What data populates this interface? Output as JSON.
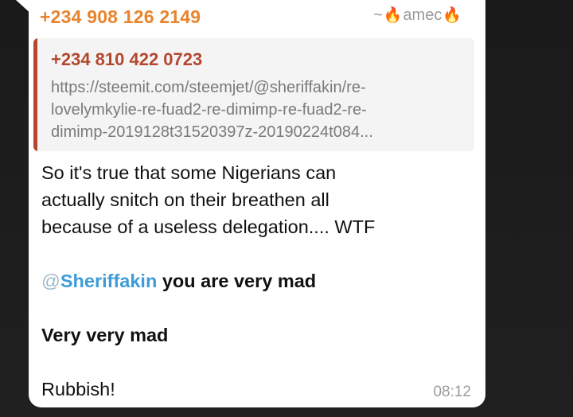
{
  "message": {
    "sender_phone": "+234 908 126 2149",
    "sender_tag_prefix": "~",
    "sender_tag_name": "amec",
    "fire_icon": "🔥",
    "reply": {
      "author": "+234 810 422 0723",
      "line_1": "https://steemit.com/steemjet/@sheriffakin/re-",
      "line_2": "lovelymkylie-re-fuad2-re-dimimp-re-fuad2-re-",
      "line_3": "dimimp-2019128t31520397z-20190224t084..."
    },
    "body": {
      "line_1": "So it's true that some Nigerians can",
      "line_2": "actually snitch on their breathen all",
      "line_3": "because of a useless delegation.... WTF",
      "mention_at": "@",
      "mention_name": "Sheriffakin",
      "mention_rest": " you are very mad",
      "line_5": "Very very mad",
      "line_6": "Rubbish!"
    },
    "time": "08:12"
  },
  "colors": {
    "sender": "#e8842c",
    "reply_accent": "#b5472f",
    "mention": "#3d9cd8",
    "background": "#1c1c1c"
  }
}
